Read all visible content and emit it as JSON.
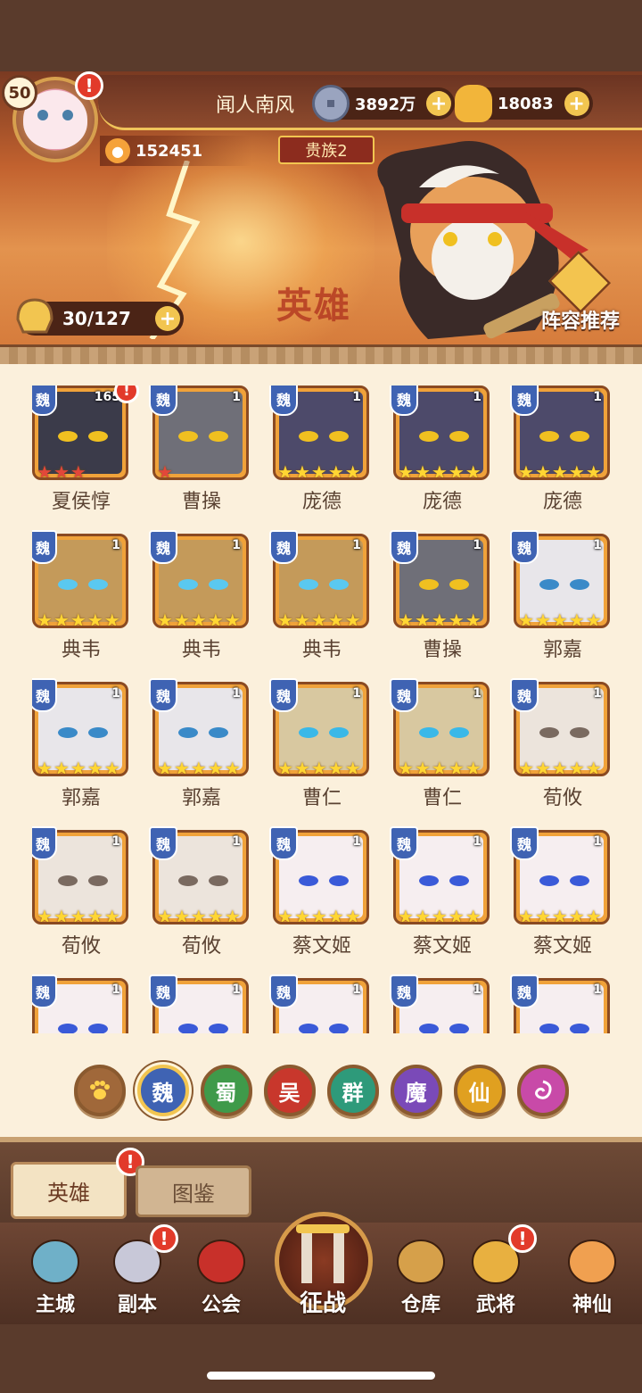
{
  "player": {
    "level": "50",
    "name": "闻人南风",
    "power": "152451",
    "vip": "贵族2",
    "alert": "!"
  },
  "currencies": [
    {
      "icon": "coin-icon",
      "value": "3892万"
    },
    {
      "icon": "gold-ingot-icon",
      "value": "18083"
    }
  ],
  "banner": {
    "title": "英雄",
    "hero_count": "30/127",
    "lineup_label": "阵容推荐"
  },
  "heroes": [
    {
      "faction": "魏",
      "level": "165",
      "stars": 3,
      "star_color": "red",
      "name": "夏侯惇",
      "alert": true,
      "face": "#3b3b4a",
      "eye": "#f0c020"
    },
    {
      "faction": "魏",
      "level": "1",
      "stars": 1,
      "star_color": "red",
      "name": "曹操",
      "alert": false,
      "face": "#6f6f78",
      "eye": "#f0c020"
    },
    {
      "faction": "魏",
      "level": "1",
      "stars": 5,
      "star_color": "gold",
      "name": "庞德",
      "alert": false,
      "face": "#4d4a6a",
      "eye": "#f0c020"
    },
    {
      "faction": "魏",
      "level": "1",
      "stars": 5,
      "star_color": "gold",
      "name": "庞德",
      "alert": false,
      "face": "#4d4a6a",
      "eye": "#f0c020"
    },
    {
      "faction": "魏",
      "level": "1",
      "stars": 5,
      "star_color": "gold",
      "name": "庞德",
      "alert": false,
      "face": "#4d4a6a",
      "eye": "#f0c020"
    },
    {
      "faction": "魏",
      "level": "1",
      "stars": 5,
      "star_color": "gold",
      "name": "典韦",
      "alert": false,
      "face": "#c49a5a",
      "eye": "#5ac8f0"
    },
    {
      "faction": "魏",
      "level": "1",
      "stars": 5,
      "star_color": "gold",
      "name": "典韦",
      "alert": false,
      "face": "#c49a5a",
      "eye": "#5ac8f0"
    },
    {
      "faction": "魏",
      "level": "1",
      "stars": 5,
      "star_color": "gold",
      "name": "典韦",
      "alert": false,
      "face": "#c49a5a",
      "eye": "#5ac8f0"
    },
    {
      "faction": "魏",
      "level": "1",
      "stars": 5,
      "star_color": "gold",
      "name": "曹操",
      "alert": false,
      "face": "#6f6f78",
      "eye": "#f0c020"
    },
    {
      "faction": "魏",
      "level": "1",
      "stars": 5,
      "star_color": "gold",
      "name": "郭嘉",
      "alert": false,
      "face": "#e8e6ea",
      "eye": "#3a8ac8"
    },
    {
      "faction": "魏",
      "level": "1",
      "stars": 5,
      "star_color": "gold",
      "name": "郭嘉",
      "alert": false,
      "face": "#e8e6ea",
      "eye": "#3a8ac8"
    },
    {
      "faction": "魏",
      "level": "1",
      "stars": 5,
      "star_color": "gold",
      "name": "郭嘉",
      "alert": false,
      "face": "#e8e6ea",
      "eye": "#3a8ac8"
    },
    {
      "faction": "魏",
      "level": "1",
      "stars": 5,
      "star_color": "gold",
      "name": "曹仁",
      "alert": false,
      "face": "#d8c8a0",
      "eye": "#3ab8e8"
    },
    {
      "faction": "魏",
      "level": "1",
      "stars": 5,
      "star_color": "gold",
      "name": "曹仁",
      "alert": false,
      "face": "#d8c8a0",
      "eye": "#3ab8e8"
    },
    {
      "faction": "魏",
      "level": "1",
      "stars": 5,
      "star_color": "gold",
      "name": "荀攸",
      "alert": false,
      "face": "#ece4dc",
      "eye": "#7a6a60"
    },
    {
      "faction": "魏",
      "level": "1",
      "stars": 5,
      "star_color": "gold",
      "name": "荀攸",
      "alert": false,
      "face": "#ece4dc",
      "eye": "#7a6a60"
    },
    {
      "faction": "魏",
      "level": "1",
      "stars": 5,
      "star_color": "gold",
      "name": "荀攸",
      "alert": false,
      "face": "#ece4dc",
      "eye": "#7a6a60"
    },
    {
      "faction": "魏",
      "level": "1",
      "stars": 5,
      "star_color": "gold",
      "name": "蔡文姬",
      "alert": false,
      "face": "#f6eef0",
      "eye": "#3a5ad8"
    },
    {
      "faction": "魏",
      "level": "1",
      "stars": 5,
      "star_color": "gold",
      "name": "蔡文姬",
      "alert": false,
      "face": "#f6eef0",
      "eye": "#3a5ad8"
    },
    {
      "faction": "魏",
      "level": "1",
      "stars": 5,
      "star_color": "gold",
      "name": "蔡文姬",
      "alert": false,
      "face": "#f6eef0",
      "eye": "#3a5ad8"
    },
    {
      "faction": "魏",
      "level": "1",
      "stars": 0,
      "star_color": "gold",
      "name": "",
      "alert": false,
      "face": "#f6eef0",
      "eye": "#3a5ad8"
    },
    {
      "faction": "魏",
      "level": "1",
      "stars": 0,
      "star_color": "gold",
      "name": "",
      "alert": false,
      "face": "#f6eef0",
      "eye": "#3a5ad8"
    },
    {
      "faction": "魏",
      "level": "1",
      "stars": 0,
      "star_color": "gold",
      "name": "",
      "alert": false,
      "face": "#f6eef0",
      "eye": "#3a5ad8"
    },
    {
      "faction": "魏",
      "level": "1",
      "stars": 0,
      "star_color": "gold",
      "name": "",
      "alert": false,
      "face": "#f6eef0",
      "eye": "#3a5ad8"
    },
    {
      "faction": "魏",
      "level": "1",
      "stars": 0,
      "star_color": "gold",
      "name": "",
      "alert": false,
      "face": "#f6eef0",
      "eye": "#3a5ad8"
    }
  ],
  "factions": [
    {
      "id": "all",
      "label": "",
      "icon": "paw-icon",
      "color": "#a0683a",
      "active": false
    },
    {
      "id": "wei",
      "label": "魏",
      "color": "#3f63b3",
      "active": true
    },
    {
      "id": "shu",
      "label": "蜀",
      "color": "#3f9a4a",
      "active": false
    },
    {
      "id": "wu",
      "label": "吴",
      "color": "#c8372c",
      "active": false
    },
    {
      "id": "qun",
      "label": "群",
      "color": "#2e9a7a",
      "active": false
    },
    {
      "id": "mo",
      "label": "魔",
      "color": "#7a4ab8",
      "active": false
    },
    {
      "id": "xian",
      "label": "仙",
      "color": "#e0a020",
      "active": false
    },
    {
      "id": "special",
      "label": "",
      "icon": "swirl-icon",
      "color": "#c84aa8",
      "active": false
    }
  ],
  "tabs": [
    {
      "label": "英雄",
      "active": true,
      "alert": true
    },
    {
      "label": "图鉴",
      "active": false,
      "alert": false
    }
  ],
  "nav": [
    {
      "label": "主城",
      "icon": "city-icon",
      "alert": false
    },
    {
      "label": "副本",
      "icon": "sword-icon",
      "alert": true
    },
    {
      "label": "公会",
      "icon": "guild-flag-icon",
      "alert": false
    },
    {
      "label": "征战",
      "icon": "battle-gate-icon",
      "alert": false,
      "center": true
    },
    {
      "label": "仓库",
      "icon": "bag-icon",
      "alert": false
    },
    {
      "label": "武将",
      "icon": "hero-icon",
      "alert": true
    },
    {
      "label": "神仙",
      "icon": "cat-icon",
      "alert": false
    }
  ]
}
